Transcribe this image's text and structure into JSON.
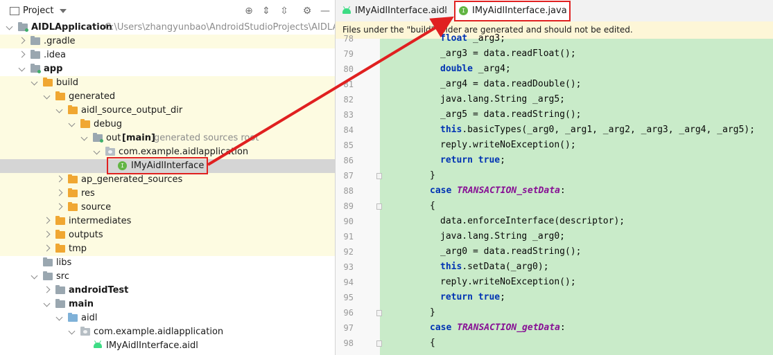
{
  "project_panel": {
    "title": "Project",
    "tree": [
      {
        "label": "AIDLApplication",
        "hint": "C:\\Users\\zhangyunbao\\AndroidStudioProjects\\AIDLApplic",
        "bold": true,
        "icon": "module-folder-icon"
      },
      {
        "label": ".gradle",
        "icon": "folder-icon"
      },
      {
        "label": ".idea",
        "icon": "folder-icon"
      },
      {
        "label": "app",
        "bold": true,
        "icon": "module-folder-icon"
      },
      {
        "label": "build",
        "icon": "orange-folder-icon"
      },
      {
        "label": "generated",
        "icon": "orange-folder-icon"
      },
      {
        "label": "aidl_source_output_dir",
        "icon": "orange-folder-icon"
      },
      {
        "label": "debug",
        "icon": "orange-folder-icon"
      },
      {
        "label": "out",
        "bold_suffix": "[main]",
        "hint": "generated sources root",
        "icon": "source-root-icon"
      },
      {
        "label": "com.example.aidlapplication",
        "icon": "package-icon"
      },
      {
        "label": "IMyAidlInterface",
        "icon": "interface-icon"
      },
      {
        "label": "ap_generated_sources",
        "icon": "orange-folder-icon"
      },
      {
        "label": "res",
        "icon": "orange-folder-icon"
      },
      {
        "label": "source",
        "icon": "orange-folder-icon"
      },
      {
        "label": "intermediates",
        "icon": "orange-folder-icon"
      },
      {
        "label": "outputs",
        "icon": "orange-folder-icon"
      },
      {
        "label": "tmp",
        "icon": "orange-folder-icon"
      },
      {
        "label": "libs",
        "icon": "folder-icon"
      },
      {
        "label": "src",
        "icon": "folder-icon"
      },
      {
        "label": "androidTest",
        "bold": true,
        "icon": "folder-icon"
      },
      {
        "label": "main",
        "bold": true,
        "icon": "folder-icon"
      },
      {
        "label": "aidl",
        "icon": "aidl-folder-icon"
      },
      {
        "label": "com.example.aidlapplication",
        "icon": "package-icon"
      },
      {
        "label": "IMyAidlInterface.aidl",
        "icon": "android-icon"
      }
    ]
  },
  "editor": {
    "tabs": [
      {
        "label": "IMyAidlInterface.aidl",
        "icon": "android-icon",
        "close": "×"
      },
      {
        "label": "IMyAidlInterface.java",
        "icon": "interface-icon"
      }
    ],
    "banner": "Files under the \"build\" folder are generated and should not be edited.",
    "lines": [
      {
        "n": "78",
        "text": "float _arg3;"
      },
      {
        "n": "79",
        "text": "_arg3 = data.readFloat();"
      },
      {
        "n": "80",
        "text": "double _arg4;"
      },
      {
        "n": "81",
        "text": "_arg4 = data.readDouble();"
      },
      {
        "n": "82",
        "text": "java.lang.String _arg5;"
      },
      {
        "n": "83",
        "text": "_arg5 = data.readString();"
      },
      {
        "n": "84",
        "text": "this.basicTypes(_arg0, _arg1, _arg2, _arg3, _arg4, _arg5);"
      },
      {
        "n": "85",
        "text": "reply.writeNoException();"
      },
      {
        "n": "86",
        "text": "return true;"
      },
      {
        "n": "87",
        "text": "}"
      },
      {
        "n": "88",
        "text": "case TRANSACTION_setData:"
      },
      {
        "n": "89",
        "text": "{"
      },
      {
        "n": "90",
        "text": "data.enforceInterface(descriptor);"
      },
      {
        "n": "91",
        "text": "java.lang.String _arg0;"
      },
      {
        "n": "92",
        "text": "_arg0 = data.readString();"
      },
      {
        "n": "93",
        "text": "this.setData(_arg0);"
      },
      {
        "n": "94",
        "text": "reply.writeNoException();"
      },
      {
        "n": "95",
        "text": "return true;"
      },
      {
        "n": "96",
        "text": "}"
      },
      {
        "n": "97",
        "text": "case TRANSACTION_getData:"
      },
      {
        "n": "98",
        "text": "{"
      }
    ]
  },
  "annotation_color": "#e02020"
}
